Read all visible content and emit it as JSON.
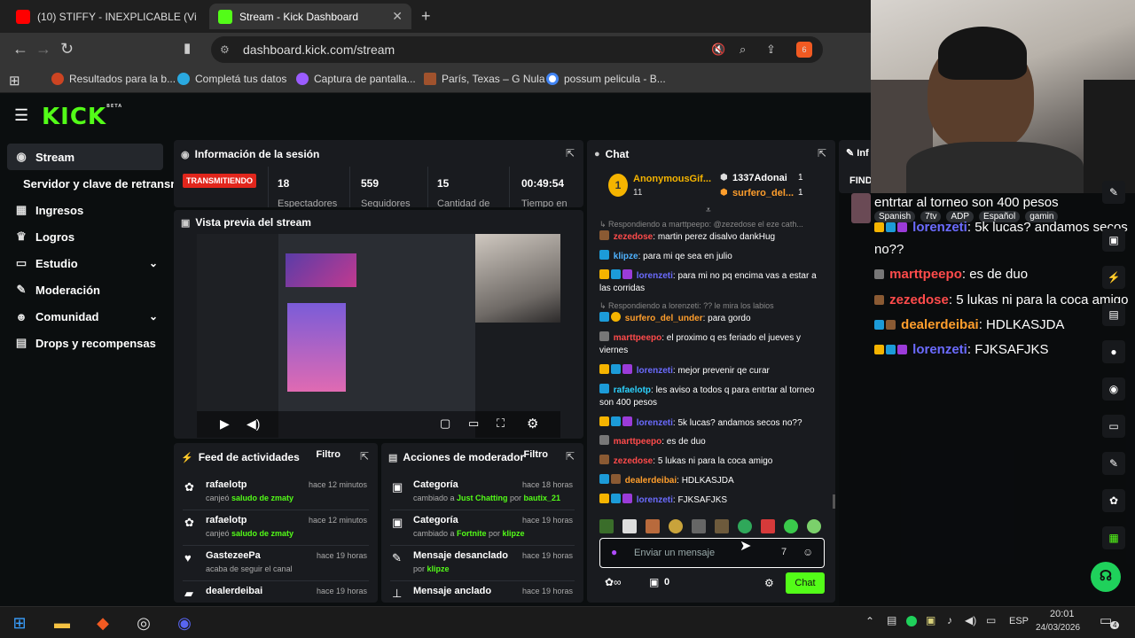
{
  "browser": {
    "tabs": [
      {
        "title": "(10) STIFFY - INEXPLICABLE (Video Of"
      },
      {
        "title": "Stream - Kick Dashboard"
      }
    ],
    "url": "dashboard.kick.com/stream",
    "brave_badge": "6",
    "bookmarks": [
      "Resultados para la b...",
      "Completá tus datos",
      "Captura de pantalla...",
      "París, Texas – G Nula",
      "possum pelicula - B..."
    ]
  },
  "kick": {
    "logo": "KICK",
    "logo_beta": "BETA",
    "sidebar": [
      {
        "label": "Stream",
        "icon": "broadcast-icon"
      },
      {
        "label": "Servidor y clave de retransm",
        "icon": ""
      },
      {
        "label": "Ingresos",
        "icon": "chart-icon"
      },
      {
        "label": "Logros",
        "icon": "trophy-icon"
      },
      {
        "label": "Estudio",
        "icon": "studio-icon"
      },
      {
        "label": "Moderación",
        "icon": "wrench-icon"
      },
      {
        "label": "Comunidad",
        "icon": "community-icon"
      },
      {
        "label": "Drops y recompensas",
        "icon": "drops-icon"
      }
    ],
    "session": {
      "title": "Información de la sesión",
      "status": "TRANSMITIENDO",
      "stats": [
        {
          "value": "18",
          "label": "Espectadores"
        },
        {
          "value": "559",
          "label": "Seguidores"
        },
        {
          "value": "15",
          "label": "Cantidad de"
        },
        {
          "value": "00:49:54",
          "label": "Tiempo en"
        }
      ]
    },
    "preview": {
      "title": "Vista previa del stream"
    },
    "feed": {
      "title": "Feed de actividades",
      "filter": "Filtro",
      "items": [
        {
          "name": "rafaelotp",
          "time": "hace 12 minutos",
          "pre": "canjeó ",
          "hl": "saludo de zmaty",
          "post": ""
        },
        {
          "name": "rafaelotp",
          "time": "hace 12 minutos",
          "pre": "canjeó ",
          "hl": "saludo de zmaty",
          "post": ""
        },
        {
          "name": "GastezeePa",
          "time": "hace 19 horas",
          "pre": "acaba de seguir el canal",
          "hl": "",
          "post": ""
        },
        {
          "name": "dealerdeibai",
          "time": "hace 19 horas",
          "pre": "",
          "hl": "",
          "post": ""
        }
      ]
    },
    "modactions": {
      "title": "Acciones de moderador",
      "filter": "Filtro",
      "items": [
        {
          "name": "Categoría",
          "time": "hace 18 horas",
          "pre": "cambiado a ",
          "hl": "Just Chatting",
          "mid": " por ",
          "by": "bautix_21"
        },
        {
          "name": "Categoría",
          "time": "hace 19 horas",
          "pre": "cambiado a ",
          "hl": "Fortnite",
          "mid": " por ",
          "by": "klipze"
        },
        {
          "name": "Mensaje desanclado",
          "time": "hace 19 horas",
          "pre": "por ",
          "hl": "",
          "mid": "",
          "by": "klipze"
        },
        {
          "name": "Mensaje anclado",
          "time": "hace 19 horas",
          "pre": "",
          "hl": "",
          "mid": "",
          "by": ""
        }
      ]
    },
    "chat": {
      "title": "Chat",
      "top_gifters": [
        {
          "name": "AnonymousGif...",
          "count": "11"
        },
        {
          "name": "1337Adonai",
          "count": "1"
        },
        {
          "name": "surfero_del...",
          "count": "1"
        }
      ],
      "replies": [
        "Respondiendo a marttpeepo: @zezedose el eze cath...",
        "Respondiendo a lorenzeti: ?? le mira los labios"
      ],
      "messages": [
        {
          "user": "zezedose",
          "text": "martin perez disalvo dankHug"
        },
        {
          "user": "klipze",
          "text": "para mi qe sea en julio"
        },
        {
          "user": "lorenzeti",
          "text": "para mi no pq encima vas a estar a las corridas"
        },
        {
          "user": "surfero_del_under",
          "text": "para gordo"
        },
        {
          "user": "marttpeepo",
          "text": "el proximo q es feriado el jueves y viernes"
        },
        {
          "user": "lorenzeti",
          "text": "mejor prevenir qe curar"
        },
        {
          "user": "rafaelotp",
          "text": "les aviso a todos q para entrtar al torneo son 400 pesos"
        },
        {
          "user": "lorenzeti",
          "text": "5k lucas? andamos secos no??"
        },
        {
          "user": "marttpeepo",
          "text": "es de duo"
        },
        {
          "user": "zezedose",
          "text": "5 lukas ni para la coca amigo"
        },
        {
          "user": "dealerdeibai",
          "text": "HDLKASJDA"
        },
        {
          "user": "lorenzeti",
          "text": "FJKSAFJKS"
        }
      ],
      "input_placeholder": "Enviar un mensaje",
      "points": "0",
      "send_label": "Chat"
    },
    "info_panel": {
      "title": "Inf",
      "finder": "FIND"
    }
  },
  "overlay": {
    "tags": [
      "Spanish",
      "7tv",
      "ADP",
      "Español",
      "gamin"
    ],
    "lines": [
      {
        "user": "",
        "text": "entrtar al torneo son 400 pesos"
      },
      {
        "user": "lorenzeti",
        "text": ": 5k lucas? andamos secos"
      },
      {
        "user": "",
        "text": "no??"
      },
      {
        "user": "marttpeepo",
        "text": ": es de duo"
      },
      {
        "user": "zezedose",
        "text": ": 5 lukas ni para la coca amigo"
      },
      {
        "user": "dealerdeibai",
        "text": ": HDLKASJDA"
      },
      {
        "user": "lorenzeti",
        "text": ": FJKSAFJKS"
      }
    ]
  },
  "taskbar": {
    "lang": "ESP",
    "time": "20:01",
    "date": "24/03/2026",
    "notif": "4"
  },
  "colors": {
    "kick_green": "#53fc18",
    "live_red": "#e1261c",
    "user_colors": {
      "zezedose": "#ff4b4b",
      "klipze": "#4fb3ff",
      "lorenzeti": "#6b6bff",
      "surfero_del_under": "#ff9e2c",
      "marttpeepo": "#ff4b4b",
      "rafaelotp": "#2cd3ff",
      "dealerdeibai": "#ff9e2c"
    }
  }
}
